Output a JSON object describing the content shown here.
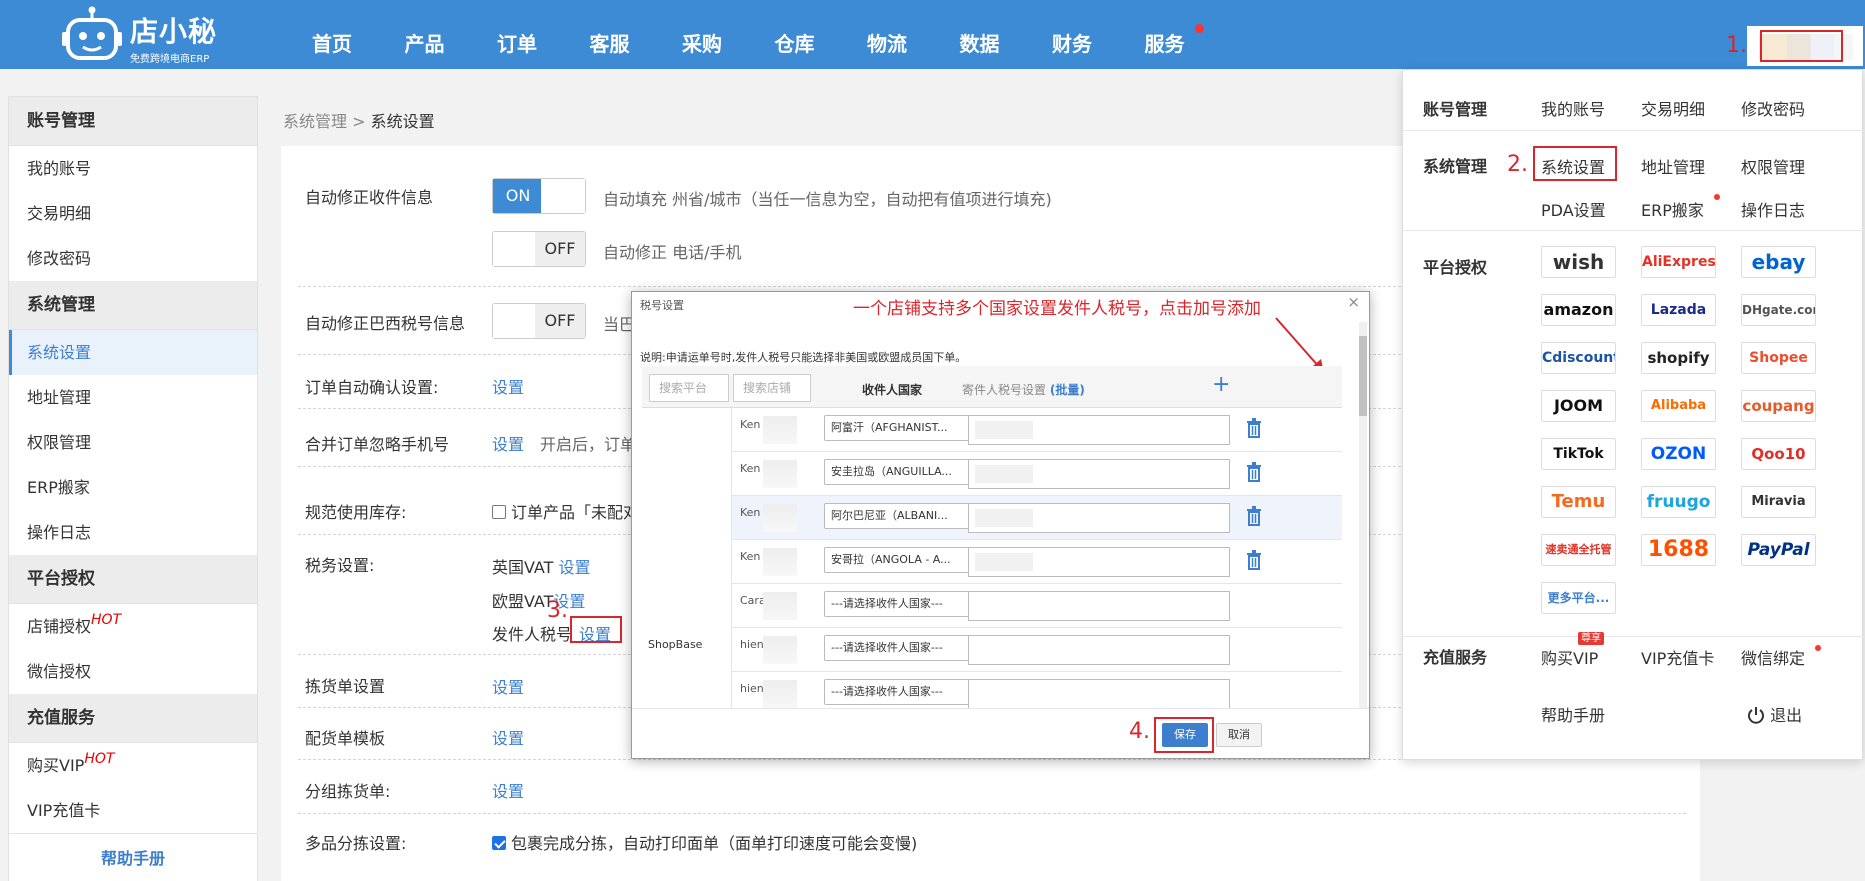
{
  "brand": {
    "name": "店小秘",
    "tagline": "免费跨境电商ERP"
  },
  "nav": [
    {
      "label": "首页"
    },
    {
      "label": "产品"
    },
    {
      "label": "订单"
    },
    {
      "label": "客服"
    },
    {
      "label": "采购"
    },
    {
      "label": "仓库"
    },
    {
      "label": "物流"
    },
    {
      "label": "数据"
    },
    {
      "label": "财务"
    },
    {
      "label": "服务"
    }
  ],
  "sidebar": {
    "sections": [
      {
        "title": "账号管理",
        "items": [
          {
            "label": "我的账号"
          },
          {
            "label": "交易明细"
          },
          {
            "label": "修改密码"
          }
        ]
      },
      {
        "title": "系统管理",
        "items": [
          {
            "label": "系统设置"
          },
          {
            "label": "地址管理"
          },
          {
            "label": "权限管理"
          },
          {
            "label": "ERP搬家"
          },
          {
            "label": "操作日志"
          }
        ]
      },
      {
        "title": "平台授权",
        "items": [
          {
            "label": "店铺授权"
          },
          {
            "label": "微信授权"
          }
        ]
      },
      {
        "title": "充值服务",
        "items": [
          {
            "label": "购买VIP"
          },
          {
            "label": "VIP充值卡"
          }
        ]
      }
    ],
    "hot": "HOT",
    "help": "帮助手册"
  },
  "breadcrumb": {
    "parent": "系统管理",
    "sep": ">",
    "current": "系统设置"
  },
  "settings": {
    "auto_fix_address": {
      "label": "自动修正收件信息",
      "toggle1": "ON",
      "desc1": "自动填充 州省/城市（当任一信息为空，自动把有值项进行填充)",
      "toggle2": "OFF",
      "desc2": "自动修正 电话/手机"
    },
    "brazil_tax": {
      "label": "自动修正巴西税号信息",
      "toggle": "OFF",
      "desc": "当巴"
    },
    "auto_confirm": {
      "label": "订单自动确认设置:",
      "link": "设置"
    },
    "merge_ignore": {
      "label": "合并订单忽略手机号",
      "link": "设置",
      "desc": "开启后，订单"
    },
    "inventory": {
      "label": "规范使用库存:",
      "desc": "订单产品「未配对"
    },
    "tax": {
      "label": "税务设置:",
      "uk": "英国VAT",
      "eu": "欧盟VAT",
      "sender": "发件人税号",
      "link": "设置"
    },
    "picking": {
      "label": "拣货单设置",
      "link": "设置"
    },
    "packing": {
      "label": "配货单模板",
      "link": "设置"
    },
    "group_picking": {
      "label": "分组拣货单:",
      "link": "设置"
    },
    "multi_sort": {
      "label": "多品分拣设置:",
      "desc": "包裹完成分拣，自动打印面单（面单打印速度可能会变慢)"
    }
  },
  "modal": {
    "title": "税号设置",
    "annotation": "一个店铺支持多个国家设置发件人税号，点击加号添加",
    "note": "说明:申请运单号时,发件人税号只能选择非美国或欧盟成员国下单。",
    "search_platform": "搜索平台",
    "search_shop": "搜索店铺",
    "col_country": "收件人国家",
    "col_tax": "寄件人税号设置",
    "batch": "(批量)",
    "platform": "ShopBase",
    "rows": [
      {
        "shop": "Ken",
        "country": "阿富汗（AFGHANIST..."
      },
      {
        "shop": "Ken",
        "country": "安圭拉岛（ANGUILLA..."
      },
      {
        "shop": "Ken",
        "country": "阿尔巴尼亚（ALBANI..."
      },
      {
        "shop": "Ken",
        "country": "安哥拉（ANGOLA - A..."
      },
      {
        "shop": "Cara",
        "country": "---请选择收件人国家---"
      },
      {
        "shop": "hien",
        "country": "---请选择收件人国家---"
      },
      {
        "shop": "hien",
        "country": "---请选择收件人国家---"
      }
    ],
    "save": "保存",
    "cancel": "取消"
  },
  "dropdown": {
    "account": {
      "title": "账号管理",
      "links": [
        "我的账号",
        "交易明细",
        "修改密码"
      ]
    },
    "system": {
      "title": "系统管理",
      "links": [
        "系统设置",
        "地址管理",
        "权限管理",
        "PDA设置",
        "ERP搬家",
        "操作日志"
      ]
    },
    "platform": {
      "title": "平台授权",
      "logos": [
        "wish",
        "AliExpress",
        "ebay",
        "amazon",
        "Lazada",
        "DHgate.com",
        "Cdiscount",
        "shopify",
        "Shopee",
        "JOOM",
        "Alibaba",
        "coupang",
        "TikTok",
        "OZON",
        "Qoo10",
        "Temu",
        "fruugo",
        "Miravia",
        "速卖通全托管",
        "1688",
        "PayPal"
      ],
      "more": "更多平台..."
    },
    "recharge": {
      "title": "充值服务",
      "links": [
        "购买VIP",
        "VIP充值卡",
        "微信绑定"
      ],
      "badge": "尊享",
      "help": "帮助手册",
      "logout": "退出"
    }
  },
  "steps": [
    "1.",
    "2.",
    "3.",
    "4."
  ],
  "colors": {
    "header": "#3d8ad5",
    "accent": "#3d7fcd",
    "annotation": "#d9262c"
  }
}
